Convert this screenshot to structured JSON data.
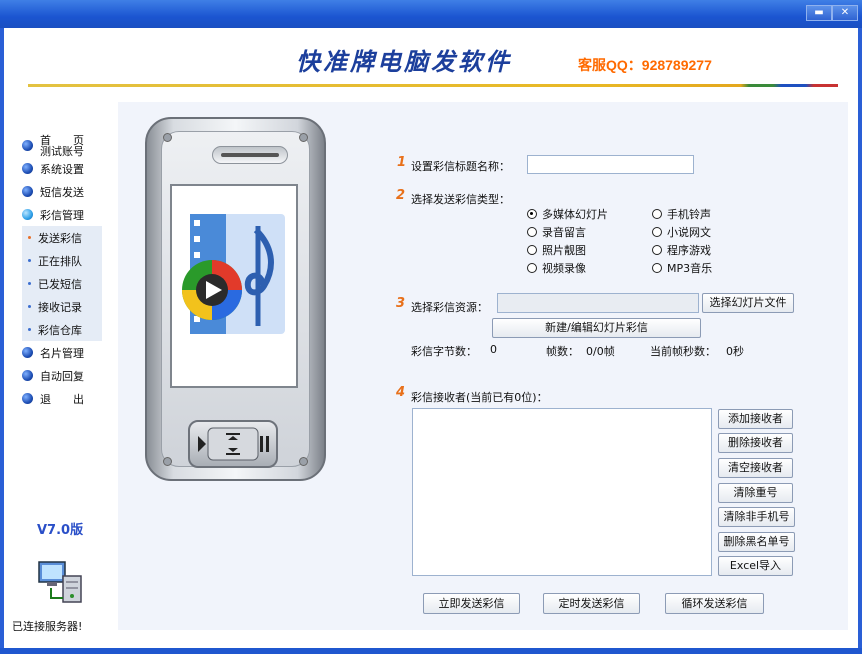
{
  "window": {
    "min_btn": "▬",
    "close_btn": "✕"
  },
  "header": {
    "app_title": "快准牌电脑发软件",
    "service": "客服QQ：928789277"
  },
  "sidebar": {
    "items": [
      {
        "label_top": "首　　页",
        "label_bottom": "测试账号"
      },
      {
        "label": "系统设置"
      },
      {
        "label": "短信发送"
      },
      {
        "label": "彩信管理"
      }
    ],
    "sub_items": [
      "发送彩信",
      "正在排队",
      "已发短信",
      "接收记录",
      "彩信仓库"
    ],
    "items_after": [
      "名片管理",
      "自动回复",
      "退　　出"
    ],
    "version": "V7.0版",
    "server_status": "已连接服务器!"
  },
  "form": {
    "step1": {
      "num": "1",
      "label": "设置彩信标题名称：",
      "value": ""
    },
    "step2": {
      "num": "2",
      "label": "选择发送彩信类型："
    },
    "types": [
      {
        "label": "多媒体幻灯片",
        "checked": true
      },
      {
        "label": "手机铃声",
        "checked": false
      },
      {
        "label": "录音留言",
        "checked": false
      },
      {
        "label": "小说网文",
        "checked": false
      },
      {
        "label": "照片靓图",
        "checked": false
      },
      {
        "label": "程序游戏",
        "checked": false
      },
      {
        "label": "视频录像",
        "checked": false
      },
      {
        "label": "MP3音乐",
        "checked": false
      }
    ],
    "step3": {
      "num": "3",
      "label": "选择彩信资源：",
      "value": "",
      "choose_button": "选择幻灯片文件",
      "create_button": "新建/编辑幻灯片彩信"
    },
    "stats": {
      "bytes_label": "彩信字节数：",
      "bytes_value": "0",
      "frames_label": "帧数：",
      "frames_value": "0/0帧",
      "seconds_label": "当前帧秒数：",
      "seconds_value": "0秒"
    },
    "step4": {
      "num": "4",
      "label": "彩信接收者(当前已有0位)："
    },
    "recipient_buttons": [
      "添加接收者",
      "删除接收者",
      "清空接收者",
      "清除重号",
      "清除非手机号",
      "删除黑名单号",
      "Excel导入"
    ],
    "send_buttons": [
      "立即发送彩信",
      "定时发送彩信",
      "循环发送彩信"
    ]
  }
}
